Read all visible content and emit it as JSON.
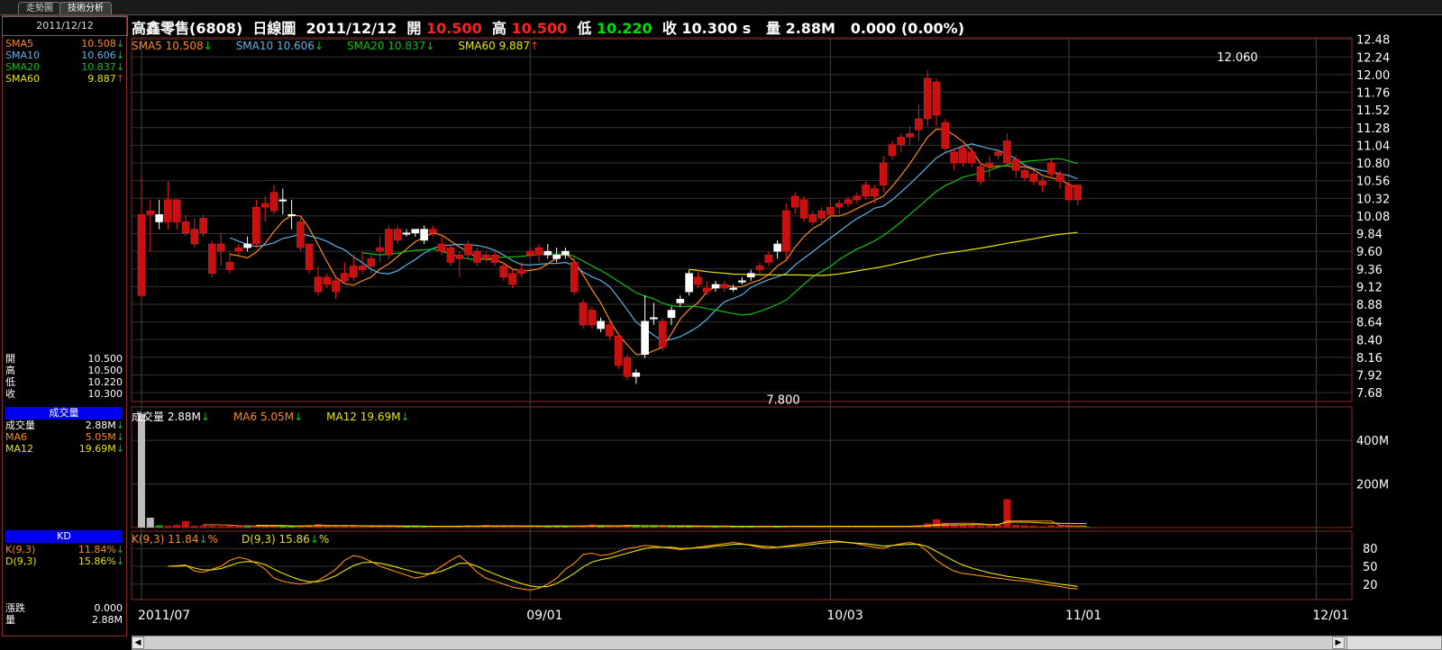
{
  "tabs": {
    "trend": "走勢圖",
    "analysis": "技術分析"
  },
  "left_panel": {
    "date": "2011/12/12",
    "sma": [
      {
        "label": "SMA5",
        "value": "10.508",
        "dir": "down",
        "color": "#ff8c1a"
      },
      {
        "label": "SMA10",
        "value": "10.606",
        "dir": "down",
        "color": "#5ab4e6"
      },
      {
        "label": "SMA20",
        "value": "10.837",
        "dir": "down",
        "color": "#10c010"
      },
      {
        "label": "SMA60",
        "value": "9.887",
        "dir": "up",
        "color": "#e6e600"
      }
    ],
    "ohlc": [
      {
        "label": "開",
        "value": "10.500"
      },
      {
        "label": "高",
        "value": "10.500"
      },
      {
        "label": "低",
        "value": "10.220"
      },
      {
        "label": "收",
        "value": "10.300"
      }
    ],
    "volume_header": "成交量",
    "volume_rows": [
      {
        "label": "成交量",
        "value": "2.88M",
        "dir": "down",
        "color": "#ffffff"
      },
      {
        "label": "MA6",
        "value": "5.05M",
        "dir": "down",
        "color": "#ff8c1a"
      },
      {
        "label": "MA12",
        "value": "19.69M",
        "dir": "down",
        "color": "#e6e600"
      }
    ],
    "kd_header": "KD",
    "kd_rows": [
      {
        "label": "K(9,3)",
        "value": "11.84%",
        "dir": "down",
        "color": "#ff8c1a"
      },
      {
        "label": "D(9,3)",
        "value": "15.86%",
        "dir": "down",
        "color": "#e6e600"
      }
    ],
    "bottom_rows": [
      {
        "label": "漲跌",
        "value": "0.000"
      },
      {
        "label": "量",
        "value": "2.88M"
      }
    ]
  },
  "header": {
    "name": "高鑫零售(6808)",
    "chart_kind": "日線圖",
    "date": "2011/12/12",
    "open_label": "開",
    "open": "10.500",
    "high_label": "高",
    "high": "10.500",
    "low_label": "低",
    "low": "10.220",
    "close_label": "收",
    "close": "10.300 s",
    "vol_label": "量",
    "vol": "2.88M",
    "change": "0.000 (0.00%)"
  },
  "price_legend": [
    {
      "text": "SMA5 10.508",
      "dir": "down",
      "color": "#ff8c1a"
    },
    {
      "text": "SMA10 10.606",
      "dir": "down",
      "color": "#5ab4e6"
    },
    {
      "text": "SMA20 10.837",
      "dir": "down",
      "color": "#10c010"
    },
    {
      "text": "SMA60 9.887",
      "dir": "up",
      "color": "#e6e600"
    }
  ],
  "vol_legend": [
    {
      "text": "成交量 2.88M",
      "dir": "down",
      "color": "#ffffff"
    },
    {
      "text": "MA6 5.05M",
      "dir": "down",
      "color": "#ff8c1a"
    },
    {
      "text": "MA12 19.69M",
      "dir": "down",
      "color": "#e6e600"
    }
  ],
  "kd_legend": [
    {
      "text": "K(9,3) 11.84",
      "suffix": "%",
      "dir": "down",
      "color": "#ff8c1a"
    },
    {
      "text": "D(9,3) 15.86",
      "suffix": "%",
      "dir": "down",
      "color": "#e6e600"
    }
  ],
  "chart_data": [
    {
      "type": "candlestick",
      "title": "",
      "ylim": [
        7.56,
        12.5
      ],
      "yticks": [
        "12.48",
        "12.24",
        "12.00",
        "11.76",
        "11.52",
        "11.28",
        "11.04",
        "10.80",
        "10.56",
        "10.32",
        "10.08",
        "9.84",
        "9.60",
        "9.36",
        "9.12",
        "8.88",
        "8.64",
        "8.40",
        "8.16",
        "7.92",
        "7.68"
      ],
      "xticks": [
        {
          "label": "2011/07",
          "i": 0
        },
        {
          "label": "09/01",
          "i": 44
        },
        {
          "label": "10/03",
          "i": 78
        },
        {
          "label": "11/01",
          "i": 105
        },
        {
          "label": "12/01",
          "i": 133
        }
      ],
      "annotations": [
        {
          "text": "12.060",
          "i": 124,
          "value": 12.06
        },
        {
          "text": "7.800",
          "i": 73,
          "value": 7.8
        }
      ],
      "candles": [
        [
          10.1,
          10.6,
          8.95,
          9.0
        ],
        [
          10.15,
          10.3,
          9.6,
          10.1
        ],
        [
          10.0,
          10.3,
          9.9,
          10.1
        ],
        [
          10.3,
          10.55,
          9.9,
          10.0
        ],
        [
          10.3,
          10.3,
          9.9,
          10.0
        ],
        [
          10.0,
          10.1,
          9.8,
          9.85
        ],
        [
          9.9,
          10.05,
          9.65,
          9.7
        ],
        [
          10.05,
          10.1,
          9.8,
          9.85
        ],
        [
          9.7,
          9.75,
          9.25,
          9.3
        ],
        [
          9.7,
          9.85,
          9.4,
          9.6
        ],
        [
          9.45,
          9.6,
          9.3,
          9.35
        ],
        [
          9.65,
          9.7,
          9.55,
          9.6
        ],
        [
          9.65,
          9.8,
          9.6,
          9.7
        ],
        [
          10.2,
          10.3,
          9.65,
          9.7
        ],
        [
          10.25,
          10.35,
          10.0,
          10.2
        ],
        [
          10.4,
          10.5,
          10.1,
          10.15
        ],
        [
          10.3,
          10.45,
          10.1,
          10.3
        ],
        [
          10.1,
          10.3,
          9.9,
          10.1
        ],
        [
          10.0,
          10.05,
          9.6,
          9.65
        ],
        [
          9.7,
          9.7,
          9.3,
          9.35
        ],
        [
          9.25,
          9.4,
          9.0,
          9.05
        ],
        [
          9.25,
          9.3,
          9.1,
          9.15
        ],
        [
          9.2,
          9.25,
          8.95,
          9.05
        ],
        [
          9.3,
          9.45,
          9.15,
          9.2
        ],
        [
          9.4,
          9.55,
          9.2,
          9.25
        ],
        [
          9.4,
          9.6,
          9.3,
          9.35
        ],
        [
          9.5,
          9.55,
          9.3,
          9.4
        ],
        [
          9.65,
          9.8,
          9.45,
          9.6
        ],
        [
          9.9,
          9.95,
          9.5,
          9.55
        ],
        [
          9.9,
          9.95,
          9.7,
          9.75
        ],
        [
          9.85,
          9.9,
          9.8,
          9.85
        ],
        [
          9.85,
          9.9,
          9.8,
          9.9
        ],
        [
          9.75,
          9.95,
          9.7,
          9.9
        ],
        [
          9.9,
          9.95,
          9.8,
          9.85
        ],
        [
          9.7,
          9.8,
          9.55,
          9.6
        ],
        [
          9.65,
          9.7,
          9.4,
          9.45
        ],
        [
          9.55,
          9.6,
          9.25,
          9.5
        ],
        [
          9.7,
          9.75,
          9.5,
          9.55
        ],
        [
          9.6,
          9.65,
          9.4,
          9.45
        ],
        [
          9.55,
          9.6,
          9.45,
          9.5
        ],
        [
          9.55,
          9.6,
          9.4,
          9.45
        ],
        [
          9.4,
          9.45,
          9.2,
          9.25
        ],
        [
          9.3,
          9.35,
          9.1,
          9.15
        ],
        [
          9.35,
          9.45,
          9.25,
          9.3
        ],
        [
          9.6,
          9.65,
          9.5,
          9.55
        ],
        [
          9.65,
          9.7,
          9.45,
          9.55
        ],
        [
          9.55,
          9.7,
          9.5,
          9.6
        ],
        [
          9.5,
          9.65,
          9.45,
          9.55
        ],
        [
          9.55,
          9.65,
          9.5,
          9.6
        ],
        [
          9.45,
          9.55,
          9.0,
          9.05
        ],
        [
          8.9,
          8.95,
          8.55,
          8.6
        ],
        [
          8.8,
          8.85,
          8.55,
          8.6
        ],
        [
          8.55,
          8.7,
          8.5,
          8.65
        ],
        [
          8.6,
          8.65,
          8.4,
          8.45
        ],
        [
          8.45,
          8.5,
          8.0,
          8.05
        ],
        [
          8.15,
          8.2,
          7.85,
          7.9
        ],
        [
          7.9,
          8.0,
          7.8,
          7.95
        ],
        [
          8.2,
          9.0,
          8.15,
          8.65
        ],
        [
          8.7,
          8.9,
          8.6,
          8.7
        ],
        [
          8.65,
          8.7,
          8.25,
          8.3
        ],
        [
          8.7,
          8.85,
          8.6,
          8.8
        ],
        [
          8.9,
          9.0,
          8.85,
          8.95
        ],
        [
          9.05,
          9.35,
          9.0,
          9.3
        ],
        [
          9.25,
          9.35,
          9.1,
          9.15
        ],
        [
          9.1,
          9.2,
          9.0,
          9.05
        ],
        [
          9.1,
          9.2,
          9.05,
          9.15
        ],
        [
          9.15,
          9.2,
          9.05,
          9.1
        ],
        [
          9.1,
          9.15,
          9.05,
          9.1
        ],
        [
          9.2,
          9.25,
          9.15,
          9.2
        ],
        [
          9.25,
          9.35,
          9.2,
          9.3
        ],
        [
          9.4,
          9.45,
          9.3,
          9.35
        ],
        [
          9.55,
          9.6,
          9.4,
          9.45
        ],
        [
          9.6,
          9.75,
          9.5,
          9.7
        ],
        [
          10.15,
          10.25,
          9.5,
          9.6
        ],
        [
          10.35,
          10.4,
          10.1,
          10.2
        ],
        [
          10.3,
          10.35,
          10.0,
          10.05
        ],
        [
          10.1,
          10.15,
          9.95,
          10.0
        ],
        [
          10.15,
          10.2,
          9.95,
          10.05
        ],
        [
          10.2,
          10.3,
          10.05,
          10.1
        ],
        [
          10.25,
          10.3,
          10.1,
          10.2
        ],
        [
          10.3,
          10.35,
          10.2,
          10.25
        ],
        [
          10.35,
          10.4,
          10.25,
          10.3
        ],
        [
          10.5,
          10.55,
          10.3,
          10.35
        ],
        [
          10.45,
          10.5,
          10.25,
          10.35
        ],
        [
          10.8,
          10.9,
          10.4,
          10.5
        ],
        [
          11.05,
          11.1,
          10.85,
          10.9
        ],
        [
          11.15,
          11.2,
          10.95,
          11.05
        ],
        [
          11.2,
          11.3,
          11.05,
          11.15
        ],
        [
          11.4,
          11.6,
          11.1,
          11.25
        ],
        [
          11.95,
          12.06,
          11.3,
          11.4
        ],
        [
          11.9,
          11.95,
          11.3,
          11.45
        ],
        [
          11.35,
          11.4,
          10.95,
          11.0
        ],
        [
          10.95,
          11.0,
          10.7,
          10.8
        ],
        [
          11.0,
          11.05,
          10.75,
          10.8
        ],
        [
          10.95,
          11.0,
          10.75,
          10.8
        ],
        [
          10.75,
          10.8,
          10.5,
          10.55
        ],
        [
          10.8,
          10.9,
          10.6,
          10.75
        ],
        [
          10.95,
          11.0,
          10.85,
          10.9
        ],
        [
          11.1,
          11.2,
          10.75,
          10.8
        ],
        [
          10.85,
          10.9,
          10.6,
          10.7
        ],
        [
          10.7,
          10.75,
          10.55,
          10.6
        ],
        [
          10.65,
          10.7,
          10.5,
          10.55
        ],
        [
          10.55,
          10.6,
          10.4,
          10.5
        ],
        [
          10.8,
          10.85,
          10.6,
          10.65
        ],
        [
          10.65,
          10.7,
          10.45,
          10.55
        ],
        [
          10.5,
          10.55,
          10.25,
          10.3
        ],
        [
          10.5,
          10.5,
          10.22,
          10.3
        ]
      ],
      "ma_windows": [
        5,
        10,
        20,
        60
      ],
      "sma60_start": 9.55
    },
    {
      "type": "bar",
      "title": "",
      "y_ticks": [
        "400M",
        "200M"
      ],
      "ylim": [
        0,
        520
      ],
      "unit": "M",
      "values": [
        520,
        45,
        10,
        8,
        12,
        30,
        8,
        10,
        8,
        6,
        8,
        9,
        7,
        6,
        9,
        6,
        7,
        8,
        7,
        11,
        16,
        8,
        6,
        7,
        6,
        5,
        6,
        7,
        5,
        6,
        5,
        6,
        8,
        5,
        6,
        5,
        6,
        10,
        7,
        12,
        6,
        5,
        8,
        6,
        5,
        6,
        7,
        9,
        6,
        5,
        8,
        14,
        10,
        6,
        7,
        12,
        8,
        6,
        7,
        5,
        6,
        5,
        6,
        7,
        6,
        5,
        6,
        5,
        6,
        5,
        6,
        7,
        5,
        6,
        8,
        6,
        5,
        6,
        7,
        6,
        5,
        6,
        5,
        6,
        7,
        5,
        6,
        8,
        10,
        20,
        38,
        22,
        15,
        12,
        10,
        8,
        10,
        12,
        130,
        12,
        10,
        8,
        6,
        10,
        8,
        6,
        5,
        3
      ]
    },
    {
      "type": "line",
      "title": "",
      "y_ticks": [
        80,
        50,
        20
      ],
      "ylim": [
        0,
        100
      ],
      "k": [
        50,
        51,
        52,
        42,
        40,
        45,
        50,
        60,
        65,
        62,
        55,
        45,
        30,
        25,
        22,
        20,
        22,
        26,
        35,
        45,
        60,
        68,
        65,
        58,
        50,
        45,
        40,
        35,
        30,
        33,
        40,
        50,
        60,
        68,
        55,
        40,
        30,
        25,
        20,
        15,
        12,
        10,
        13,
        20,
        30,
        45,
        55,
        70,
        72,
        68,
        70,
        75,
        80,
        82,
        85,
        84,
        82,
        80,
        78,
        80,
        82,
        84,
        86,
        88,
        90,
        88,
        85,
        82,
        80,
        82,
        84,
        86,
        88,
        90,
        92,
        93,
        92,
        90,
        88,
        85,
        82,
        80,
        85,
        88,
        90,
        86,
        75,
        60,
        50,
        42,
        38,
        36,
        34,
        32,
        30,
        28,
        26,
        25,
        23,
        20,
        18,
        16,
        13,
        12
      ],
      "d": [
        50,
        50,
        51,
        47,
        44,
        44,
        46,
        51,
        56,
        58,
        57,
        53,
        45,
        38,
        32,
        27,
        24,
        24,
        28,
        34,
        43,
        51,
        56,
        57,
        55,
        52,
        48,
        44,
        40,
        37,
        38,
        42,
        48,
        55,
        55,
        50,
        43,
        37,
        31,
        26,
        21,
        17,
        15,
        16,
        21,
        29,
        38,
        49,
        57,
        61,
        64,
        68,
        72,
        76,
        80,
        82,
        82,
        82,
        80,
        80,
        81,
        82,
        84,
        85,
        87,
        87,
        86,
        84,
        83,
        82,
        83,
        84,
        85,
        87,
        89,
        90,
        91,
        90,
        89,
        88,
        86,
        84,
        85,
        86,
        87,
        87,
        83,
        75,
        67,
        59,
        52,
        47,
        43,
        39,
        36,
        33,
        31,
        29,
        27,
        25,
        22,
        20,
        18,
        16
      ]
    }
  ]
}
